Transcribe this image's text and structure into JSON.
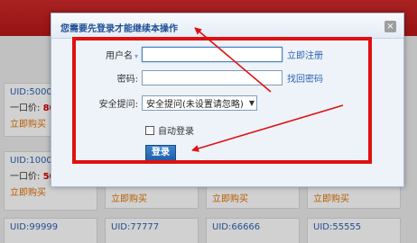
{
  "background": {
    "cards": [
      {
        "uid": "UID:5000",
        "price_label": "一口价:",
        "price_value": "80",
        "buy_label": "立即购买"
      },
      {
        "uid": "UID:1000",
        "price_label": "一口价:",
        "price_value": "50",
        "buy_label": "立即购买"
      },
      {
        "uid": "UID:99999",
        "price_label": "",
        "price_value": "",
        "buy_label": ""
      },
      {
        "uid": "UID:77777",
        "price_label": "",
        "price_value": "",
        "buy_label": ""
      },
      {
        "uid": "UID:66666",
        "price_label": "",
        "price_value": "",
        "buy_label": ""
      },
      {
        "uid": "UID:55555",
        "price_label": "",
        "price_value": "",
        "buy_label": ""
      }
    ],
    "buy_row_labels": [
      "立即购买",
      "立即购买",
      "立即购买"
    ]
  },
  "modal": {
    "title": "您需要先登录才能继续本操作",
    "close_glyph": "×",
    "username_label": "用户名",
    "username_marker": "▾",
    "username_value": "",
    "register_link": "立即注册",
    "password_label": "密码:",
    "password_value": "",
    "recover_link": "找回密码",
    "security_label": "安全提问:",
    "security_selected": "安全提问(未设置请忽略)",
    "auto_login_label": "自动登录",
    "login_button": "登录"
  },
  "colors": {
    "annotation": "#e01010",
    "link": "#2a62b3",
    "title": "#1f4f96",
    "buy": "#e07000"
  }
}
